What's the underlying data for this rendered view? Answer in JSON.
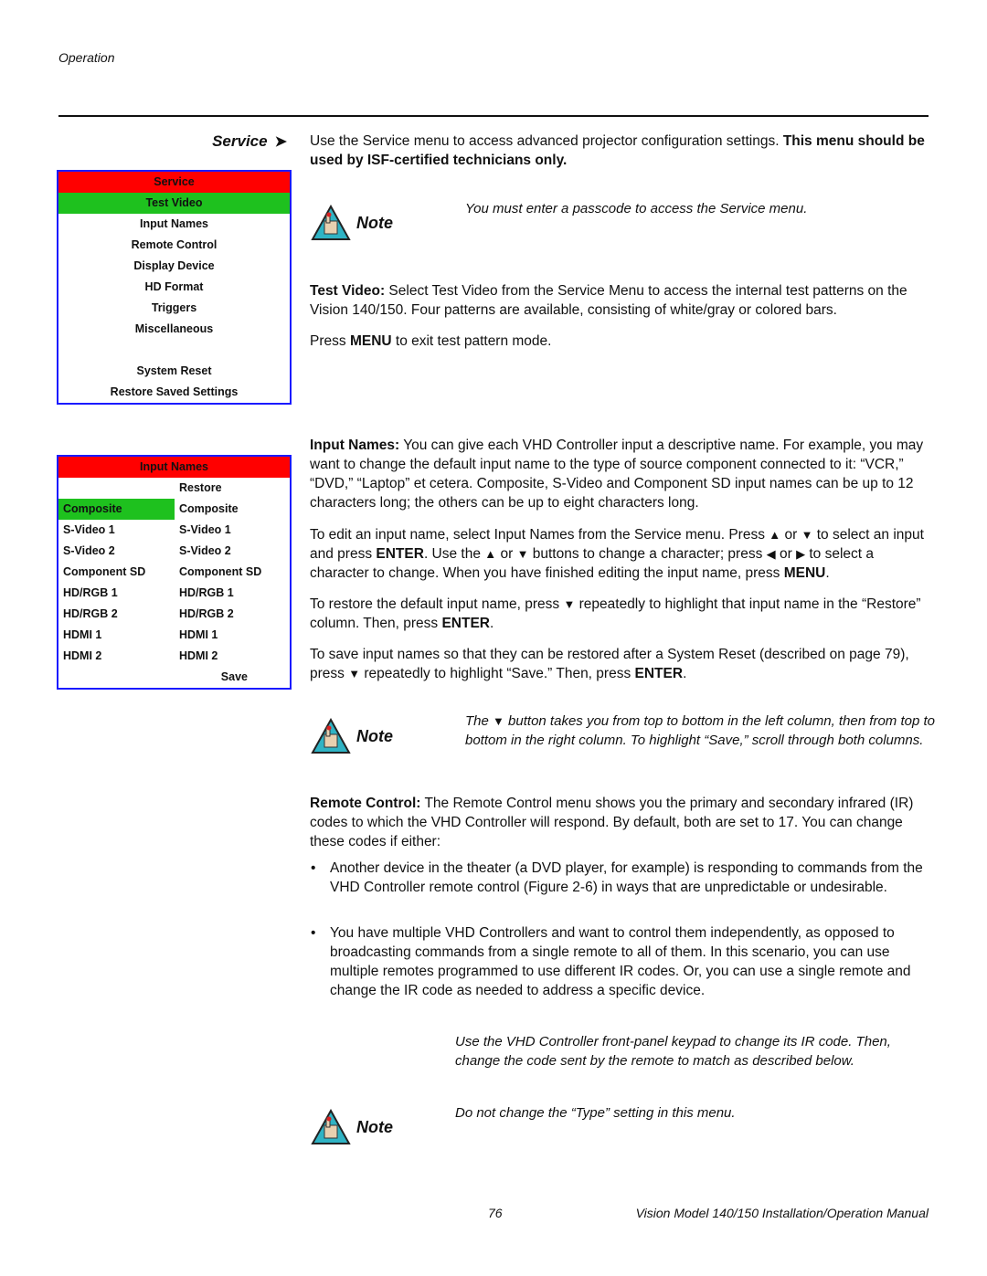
{
  "header": {
    "running_head": "Operation"
  },
  "section": {
    "label": "Service",
    "arrow_icon": "arrowhead-right-icon"
  },
  "service_menu": {
    "title": "Service",
    "selected": "Test Video",
    "items": [
      "Input Names",
      "Remote Control",
      "Display Device",
      "HD Format",
      "Triggers",
      "Miscellaneous"
    ],
    "items_after_gap": [
      "System Reset",
      "Restore Saved Settings"
    ],
    "colors": {
      "border": "#1a1aff",
      "header": "#ff0000",
      "selected": "#1ec11e"
    }
  },
  "input_names_menu": {
    "title": "Input Names",
    "restore_header": "Restore",
    "left_column": [
      "Composite",
      "S-Video 1",
      "S-Video 2",
      "Component SD",
      "HD/RGB 1",
      "HD/RGB 2",
      "HDMI 1",
      "HDMI 2"
    ],
    "right_column": [
      "Composite",
      "S-Video 1",
      "S-Video 2",
      "Component SD",
      "HD/RGB 1",
      "HD/RGB 2",
      "HDMI 1",
      "HDMI 2"
    ],
    "selected_left": "Composite",
    "save_label": "Save"
  },
  "intro": {
    "text": "Use the Service menu to access advanced projector configuration settings. ",
    "bold": "This menu should be used by ISF-certified technicians only."
  },
  "note_label": "Note",
  "notes": [
    "You must enter a passcode to access the Service menu.",
    {
      "before": "The ",
      "after": " button takes you from top to bottom in the left column, then from top to bottom in the right column. To highlight “Save,” scroll through both columns."
    },
    "Use the VHD Controller front-panel keypad to change its IR code. Then, change the code sent by the remote to match as described below.",
    "Do not change the “Type” setting in this menu."
  ],
  "test_video": {
    "label": "Test Video:",
    "text": " Select Test Video from the Service Menu to access the internal test patterns on the Vision 140/150. Four patterns are available, consisting of white/gray or colored bars.",
    "press_1": "Press ",
    "menu_key": "MENU",
    "press_2": " to exit test pattern mode."
  },
  "input_names": {
    "label": "Input Names:",
    "text": " You can give each VHD Controller input a descriptive name. For example, you may want to change the default input name to the type of source component connected to it: “VCR,” “DVD,” “Laptop” et cetera. Composite, S-Video and Component SD input names can be up to 12 characters long; the others can be up to eight characters long.",
    "edit": [
      "To edit an input name, select Input Names from the Service menu. Press ",
      " or ",
      " to select an input and press ",
      "ENTER",
      ". Use the ",
      " or ",
      " buttons to change a character; press ",
      " or ",
      " to select a character to change. When you have finished editing the input name, press ",
      "MENU",
      "."
    ],
    "restore": [
      "To restore the default input name, press ",
      " repeatedly to highlight that input name in the “Restore” column. Then, press ",
      "ENTER",
      "."
    ],
    "save": [
      "To save input names so that they can be restored after a System Reset (described on page 79), press ",
      " repeatedly to highlight “Save.” Then, press ",
      "ENTER",
      "."
    ]
  },
  "remote_control": {
    "label": "Remote Control:",
    "text": " The Remote Control menu shows you the primary and secondary infrared (IR) codes to which the VHD Controller will respond. By default, both are set to 17. You can change these codes if either:",
    "bullets": [
      "Another device in the theater (a DVD player, for example) is responding to commands from the VHD Controller remote control (Figure 2-6) in ways that are unpredictable or undesirable.",
      "You have multiple VHD Controllers and want to control them independently, as opposed to broadcasting commands from a single remote to all of them. In this scenario, you can use multiple remotes programmed to use different IR codes. Or, you can use a single remote and change the IR code as needed to address a specific device."
    ]
  },
  "glyphs": {
    "up": "▲",
    "down": "▼",
    "left": "◀",
    "right": "▶",
    "bullet": "•",
    "arrow": "➤"
  },
  "footer": {
    "page_number": "76",
    "title": "Vision Model 140/150 Installation/Operation Manual"
  }
}
